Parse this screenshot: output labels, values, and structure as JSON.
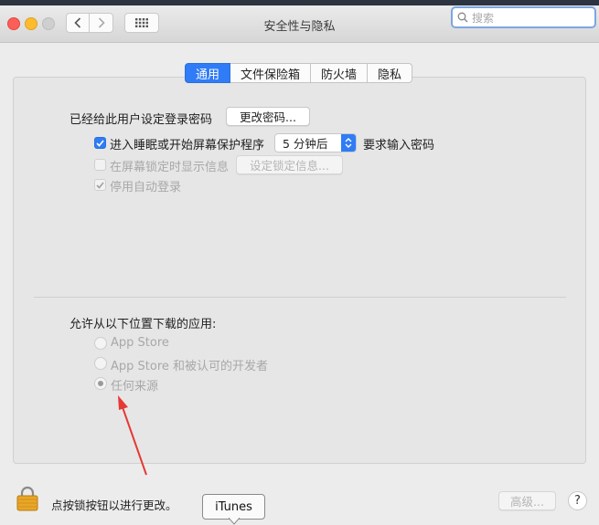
{
  "window": {
    "title": "安全性与隐私",
    "search_placeholder": "搜索"
  },
  "tabs": [
    {
      "label": "通用",
      "active": true
    },
    {
      "label": "文件保险箱",
      "active": false
    },
    {
      "label": "防火墙",
      "active": false
    },
    {
      "label": "隐私",
      "active": false
    }
  ],
  "general": {
    "password_label": "已经给此用户设定登录密码",
    "change_password_button": "更改密码...",
    "require_password": {
      "prefix": "进入睡眠或开始屏幕保护程序",
      "delay_value": "5 分钟后",
      "suffix": "要求输入密码",
      "checked": true
    },
    "show_message": {
      "label": "在屏幕锁定时显示信息",
      "checked": false,
      "button": "设定锁定信息..."
    },
    "disable_autologin": {
      "label": "停用自动登录",
      "checked": true
    }
  },
  "downloads": {
    "heading": "允许从以下位置下载的应用:",
    "options": [
      {
        "label": "App Store",
        "selected": false
      },
      {
        "label": "App Store 和被认可的开发者",
        "selected": false
      },
      {
        "label": "任何来源",
        "selected": true
      }
    ]
  },
  "footer": {
    "lock_text": "点按锁按钮以进行更改。",
    "advanced_button": "高级...",
    "help_button": "?"
  },
  "tooltip": {
    "text": "iTunes"
  },
  "colors": {
    "accent": "#2f7cf6",
    "annotation_arrow": "#e53935"
  }
}
